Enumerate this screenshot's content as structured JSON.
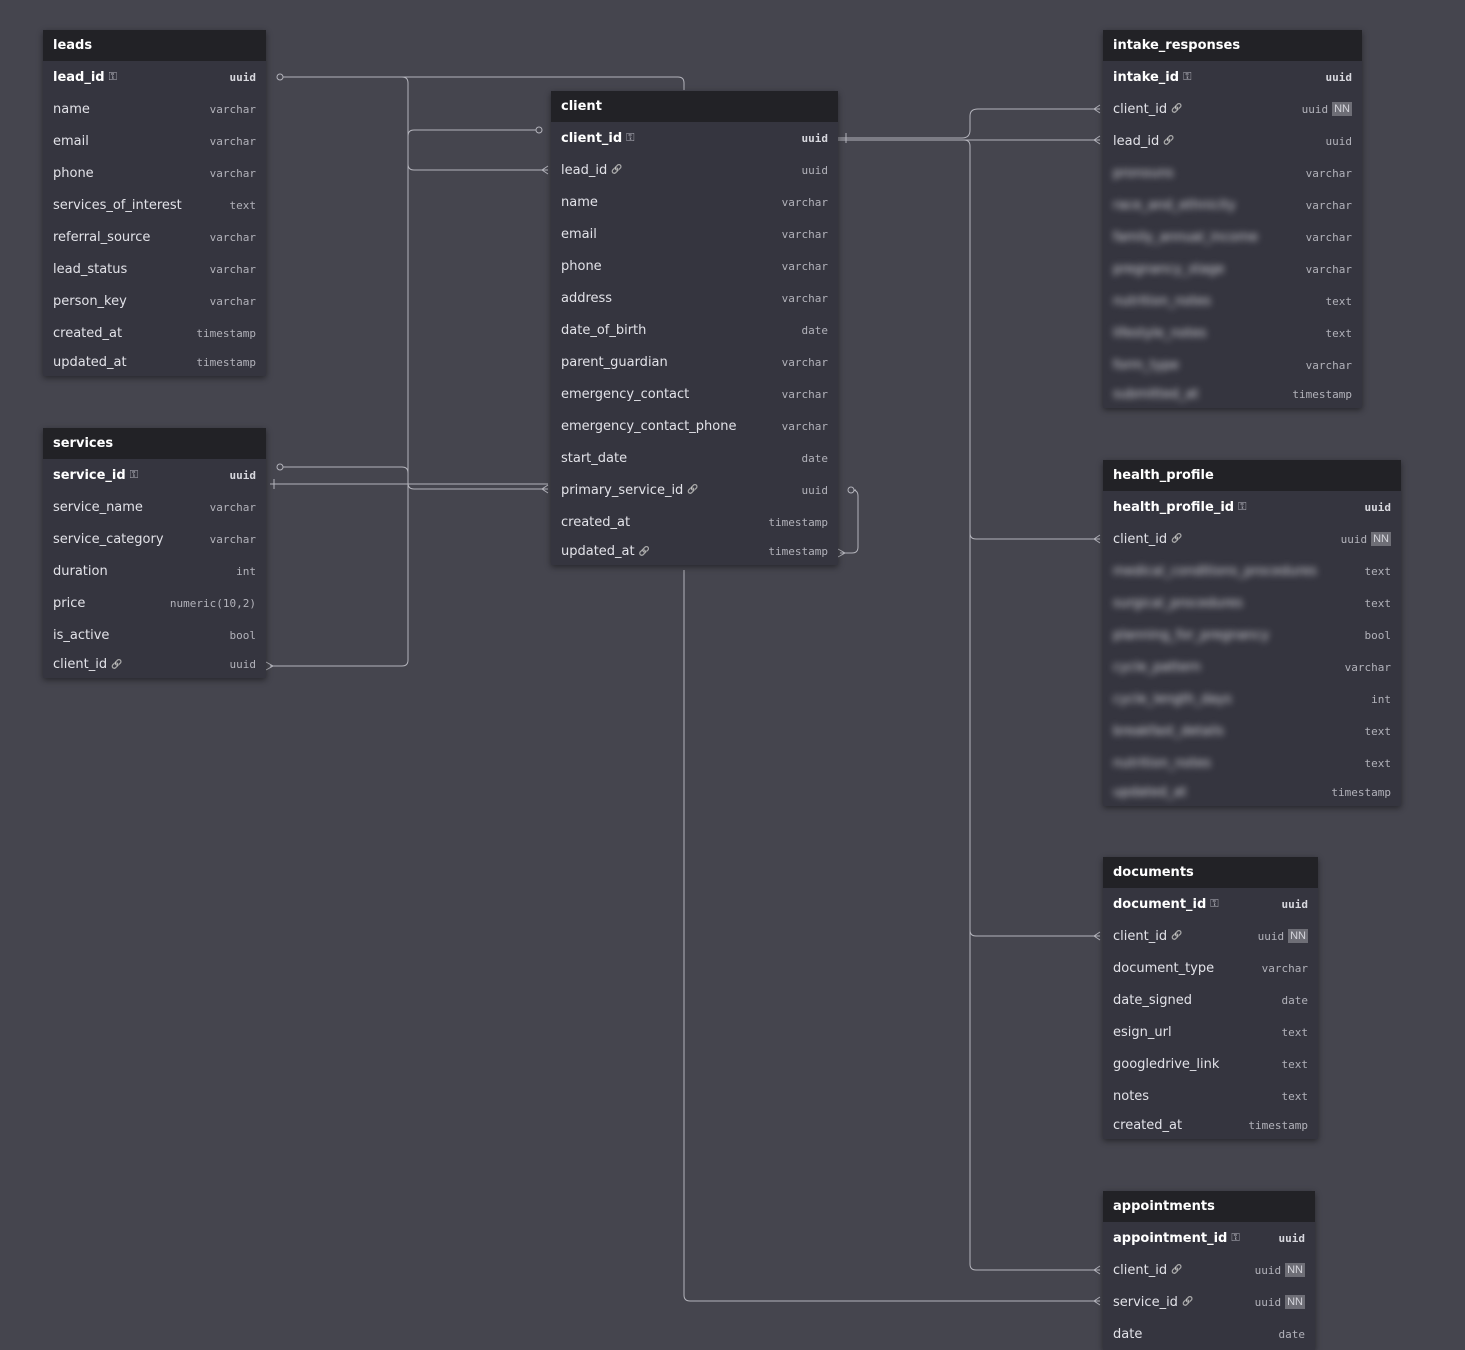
{
  "tables": [
    {
      "id": "leads",
      "name": "leads",
      "columns": [
        {
          "name": "lead_id",
          "type": "uuid",
          "pk": true
        },
        {
          "name": "name",
          "type": "varchar"
        },
        {
          "name": "email",
          "type": "varchar"
        },
        {
          "name": "phone",
          "type": "varchar"
        },
        {
          "name": "services_of_interest",
          "type": "text"
        },
        {
          "name": "referral_source",
          "type": "varchar"
        },
        {
          "name": "lead_status",
          "type": "varchar"
        },
        {
          "name": "person_key",
          "type": "varchar"
        },
        {
          "name": "created_at",
          "type": "timestamp"
        },
        {
          "name": "updated_at",
          "type": "timestamp"
        }
      ]
    },
    {
      "id": "services",
      "name": "services",
      "columns": [
        {
          "name": "service_id",
          "type": "uuid",
          "pk": true
        },
        {
          "name": "service_name",
          "type": "varchar"
        },
        {
          "name": "service_category",
          "type": "varchar"
        },
        {
          "name": "duration",
          "type": "int"
        },
        {
          "name": "price",
          "type": "numeric(10,2)"
        },
        {
          "name": "is_active",
          "type": "bool"
        },
        {
          "name": "client_id",
          "type": "uuid",
          "fk": true
        }
      ]
    },
    {
      "id": "client",
      "name": "client",
      "columns": [
        {
          "name": "client_id",
          "type": "uuid",
          "pk": true
        },
        {
          "name": "lead_id",
          "type": "uuid",
          "fk": true
        },
        {
          "name": "name",
          "type": "varchar"
        },
        {
          "name": "email",
          "type": "varchar"
        },
        {
          "name": "phone",
          "type": "varchar"
        },
        {
          "name": "address",
          "type": "varchar"
        },
        {
          "name": "date_of_birth",
          "type": "date"
        },
        {
          "name": "parent_guardian",
          "type": "varchar"
        },
        {
          "name": "emergency_contact",
          "type": "varchar"
        },
        {
          "name": "emergency_contact_phone",
          "type": "varchar"
        },
        {
          "name": "start_date",
          "type": "date"
        },
        {
          "name": "primary_service_id",
          "type": "uuid",
          "fk": true
        },
        {
          "name": "created_at",
          "type": "timestamp"
        },
        {
          "name": "updated_at",
          "type": "timestamp",
          "fk": true
        }
      ]
    },
    {
      "id": "intake_responses",
      "name": "intake_responses",
      "columns": [
        {
          "name": "intake_id",
          "type": "uuid",
          "pk": true
        },
        {
          "name": "client_id",
          "type": "uuid",
          "fk": true,
          "nn": "NN"
        },
        {
          "name": "lead_id",
          "type": "uuid",
          "fk": true
        },
        {
          "name": "pronouns",
          "type": "varchar",
          "blurred": true
        },
        {
          "name": "race_and_ethnicity",
          "type": "varchar",
          "blurred": true
        },
        {
          "name": "family_annual_income",
          "type": "varchar",
          "blurred": true
        },
        {
          "name": "pregnancy_stage",
          "type": "varchar",
          "blurred": true
        },
        {
          "name": "nutrition_notes",
          "type": "text",
          "blurred": true
        },
        {
          "name": "lifestyle_notes",
          "type": "text",
          "blurred": true
        },
        {
          "name": "form_type",
          "type": "varchar",
          "blurred": true
        },
        {
          "name": "submitted_at",
          "type": "timestamp",
          "blurred": true
        }
      ]
    },
    {
      "id": "health_profile",
      "name": "health_profile",
      "columns": [
        {
          "name": "health_profile_id",
          "type": "uuid",
          "pk": true
        },
        {
          "name": "client_id",
          "type": "uuid",
          "fk": true,
          "nn": "NN"
        },
        {
          "name": "medical_conditions_procedures",
          "type": "text",
          "blurred": true
        },
        {
          "name": "surgical_procedures",
          "type": "text",
          "blurred": true
        },
        {
          "name": "planning_for_pregnancy",
          "type": "bool",
          "blurred": true
        },
        {
          "name": "cycle_pattern",
          "type": "varchar",
          "blurred": true
        },
        {
          "name": "cycle_length_days",
          "type": "int",
          "blurred": true
        },
        {
          "name": "breakfast_details",
          "type": "text",
          "blurred": true
        },
        {
          "name": "nutrition_notes",
          "type": "text",
          "blurred": true
        },
        {
          "name": "updated_at",
          "type": "timestamp",
          "blurred": true
        }
      ]
    },
    {
      "id": "documents",
      "name": "documents",
      "columns": [
        {
          "name": "document_id",
          "type": "uuid",
          "pk": true
        },
        {
          "name": "client_id",
          "type": "uuid",
          "fk": true,
          "nn": "NN"
        },
        {
          "name": "document_type",
          "type": "varchar"
        },
        {
          "name": "date_signed",
          "type": "date"
        },
        {
          "name": "esign_url",
          "type": "text"
        },
        {
          "name": "googledrive_link",
          "type": "text"
        },
        {
          "name": "notes",
          "type": "text"
        },
        {
          "name": "created_at",
          "type": "timestamp"
        }
      ]
    },
    {
      "id": "appointments",
      "name": "appointments",
      "columns": [
        {
          "name": "appointment_id",
          "type": "uuid",
          "pk": true
        },
        {
          "name": "client_id",
          "type": "uuid",
          "fk": true,
          "nn": "NN"
        },
        {
          "name": "service_id",
          "type": "uuid",
          "fk": true,
          "nn": "NN"
        },
        {
          "name": "date",
          "type": "date"
        }
      ]
    }
  ],
  "colors": {
    "canvas": "#45454e",
    "table_body": "#35353f",
    "table_header": "#222226",
    "edge": "#b4b4bc"
  },
  "icons": {
    "primary_key": "key-icon",
    "foreign_key": "link-icon"
  }
}
